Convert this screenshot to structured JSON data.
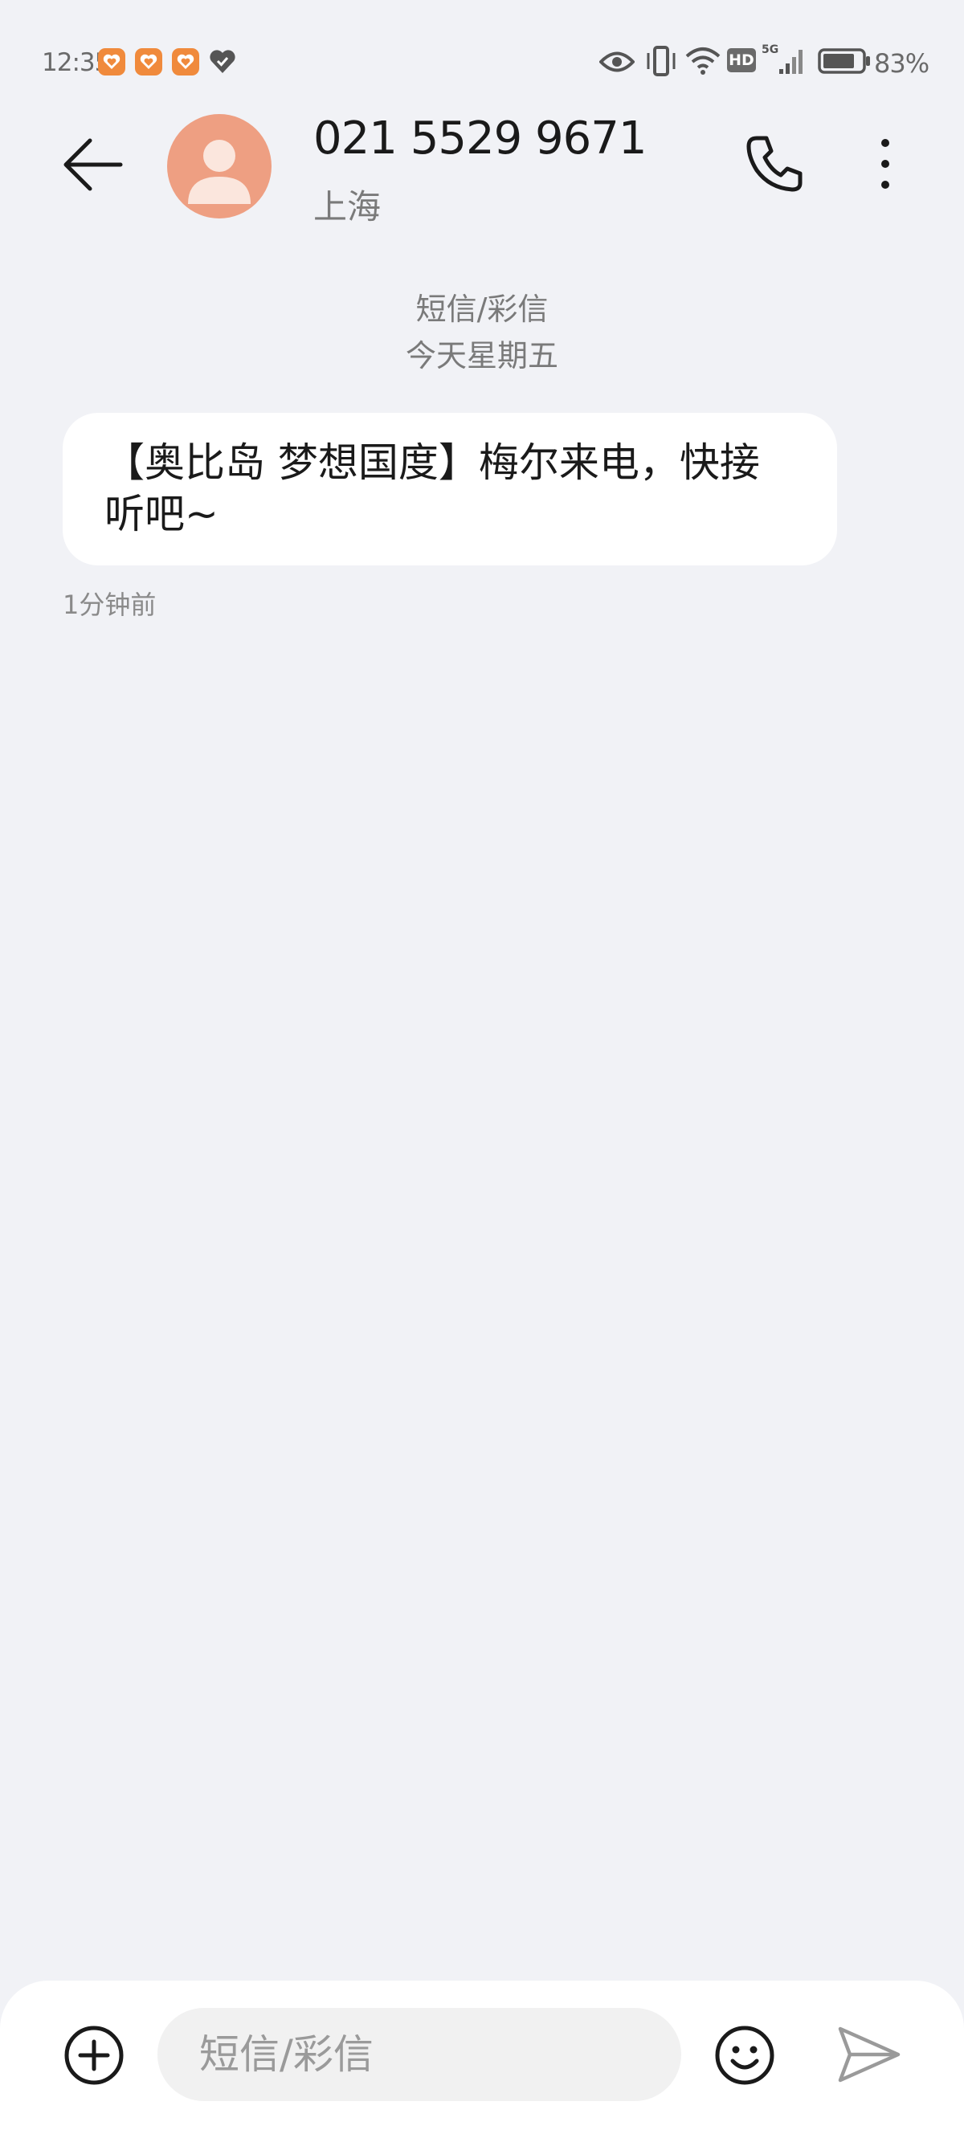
{
  "status_bar": {
    "time": "12:35",
    "battery_pct": "83%",
    "hd_label": "HD",
    "network_label": "5G",
    "battery_level": 0.83,
    "icons": [
      "notification-app-icon",
      "notification-app-icon",
      "notification-app-icon",
      "heart-check-icon",
      "eye-icon",
      "vibrate-icon",
      "wifi-icon",
      "hd-icon",
      "signal-icon",
      "battery-icon"
    ]
  },
  "header": {
    "back_icon": "arrow-left-icon",
    "contact_number": "021 5529 9671",
    "location": "上海",
    "call_icon": "phone-icon",
    "more_icon": "more-vertical-icon"
  },
  "conversation": {
    "type_label": "短信/彩信",
    "date_label": "今天星期五",
    "messages": [
      {
        "text": "【奥比岛 梦想国度】梅尔来电，快接听吧~",
        "time": "1分钟前"
      }
    ]
  },
  "compose": {
    "placeholder": "短信/彩信",
    "value": "",
    "add_icon": "plus-circle-icon",
    "emoji_icon": "smiley-icon",
    "send_icon": "send-icon"
  },
  "colors": {
    "background": "#f1f2f6",
    "avatar": "#ee9f82",
    "notification_badge": "#f08a3c"
  }
}
